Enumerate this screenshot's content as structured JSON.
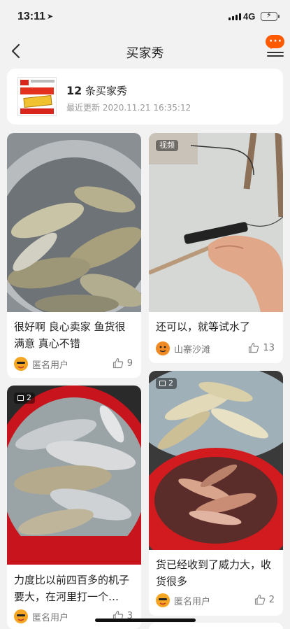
{
  "status_bar": {
    "time": "13:11",
    "location_glyph": "➤",
    "network": "4G"
  },
  "nav": {
    "title": "买家秀"
  },
  "summary": {
    "count": "12",
    "count_suffix": " 条买家秀",
    "updated": "最近更新 2020.11.21 16:35:12"
  },
  "reviews": [
    {
      "text": "很好啊 良心卖家 鱼货很满意 真心不错",
      "user": "匿名用户",
      "likes": "9",
      "badge": ""
    },
    {
      "text": "还可以，就等试水了",
      "user": "山寨沙滩",
      "likes": "13",
      "badge": "视频"
    },
    {
      "text": "力度比以前四百多的机子要大，在河里打一个…",
      "user": "匿名用户",
      "likes": "3",
      "badge": "2"
    },
    {
      "text": "货已经收到了威力大，收货很多",
      "user": "匿名用户",
      "likes": "2",
      "badge": "2"
    }
  ],
  "colors": {
    "accent": "#ff5a00",
    "background": "#f2f2f2",
    "basin_red": "#c8141c"
  }
}
